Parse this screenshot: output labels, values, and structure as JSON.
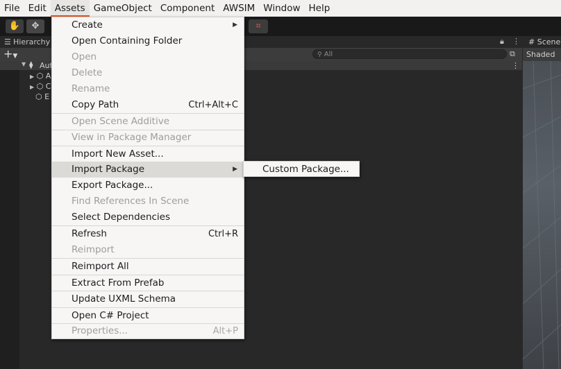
{
  "menubar": {
    "items": [
      "File",
      "Edit",
      "Assets",
      "GameObject",
      "Component",
      "AWSIM",
      "Window",
      "Help"
    ]
  },
  "hierarchy": {
    "tab_label": "Hierarchy",
    "add_label": "+",
    "search_placeholder": "All",
    "scene_name": "Aut",
    "children": [
      "A",
      "C",
      "E"
    ]
  },
  "scene": {
    "tab_label": "Scene",
    "shading_mode": "Shaded"
  },
  "assets_menu": {
    "items": [
      {
        "label": "Create",
        "shortcut": "",
        "submenu": true,
        "disabled": false
      },
      {
        "label": "Open Containing Folder",
        "shortcut": "",
        "submenu": false,
        "disabled": false
      },
      {
        "label": "Open",
        "shortcut": "",
        "submenu": false,
        "disabled": true
      },
      {
        "label": "Delete",
        "shortcut": "",
        "submenu": false,
        "disabled": true
      },
      {
        "label": "Rename",
        "shortcut": "",
        "submenu": false,
        "disabled": true
      },
      {
        "label": "Copy Path",
        "shortcut": "Ctrl+Alt+C",
        "submenu": false,
        "disabled": false
      },
      {
        "label": "Open Scene Additive",
        "shortcut": "",
        "submenu": false,
        "disabled": true
      },
      {
        "label": "View in Package Manager",
        "shortcut": "",
        "submenu": false,
        "disabled": true
      },
      {
        "label": "Import New Asset...",
        "shortcut": "",
        "submenu": false,
        "disabled": false
      },
      {
        "label": "Import Package",
        "shortcut": "",
        "submenu": true,
        "disabled": false
      },
      {
        "label": "Export Package...",
        "shortcut": "",
        "submenu": false,
        "disabled": false
      },
      {
        "label": "Find References In Scene",
        "shortcut": "",
        "submenu": false,
        "disabled": true
      },
      {
        "label": "Select Dependencies",
        "shortcut": "",
        "submenu": false,
        "disabled": false
      },
      {
        "label": "Refresh",
        "shortcut": "Ctrl+R",
        "submenu": false,
        "disabled": false
      },
      {
        "label": "Reimport",
        "shortcut": "",
        "submenu": false,
        "disabled": true
      },
      {
        "label": "Reimport All",
        "shortcut": "",
        "submenu": false,
        "disabled": false
      },
      {
        "label": "Extract From Prefab",
        "shortcut": "",
        "submenu": false,
        "disabled": false
      },
      {
        "label": "Update UXML Schema",
        "shortcut": "",
        "submenu": false,
        "disabled": false
      },
      {
        "label": "Open C# Project",
        "shortcut": "",
        "submenu": false,
        "disabled": false
      },
      {
        "label": "Properties...",
        "shortcut": "Alt+P",
        "submenu": false,
        "disabled": true
      }
    ]
  },
  "import_package_submenu": {
    "items": [
      {
        "label": "Custom Package..."
      }
    ]
  },
  "colors": {
    "menubar_bg": "#f2f1f0",
    "accent": "#e95420",
    "editor_bg": "#282828",
    "menu_bg": "#f7f6f5",
    "menu_hover": "#dcdad7"
  }
}
